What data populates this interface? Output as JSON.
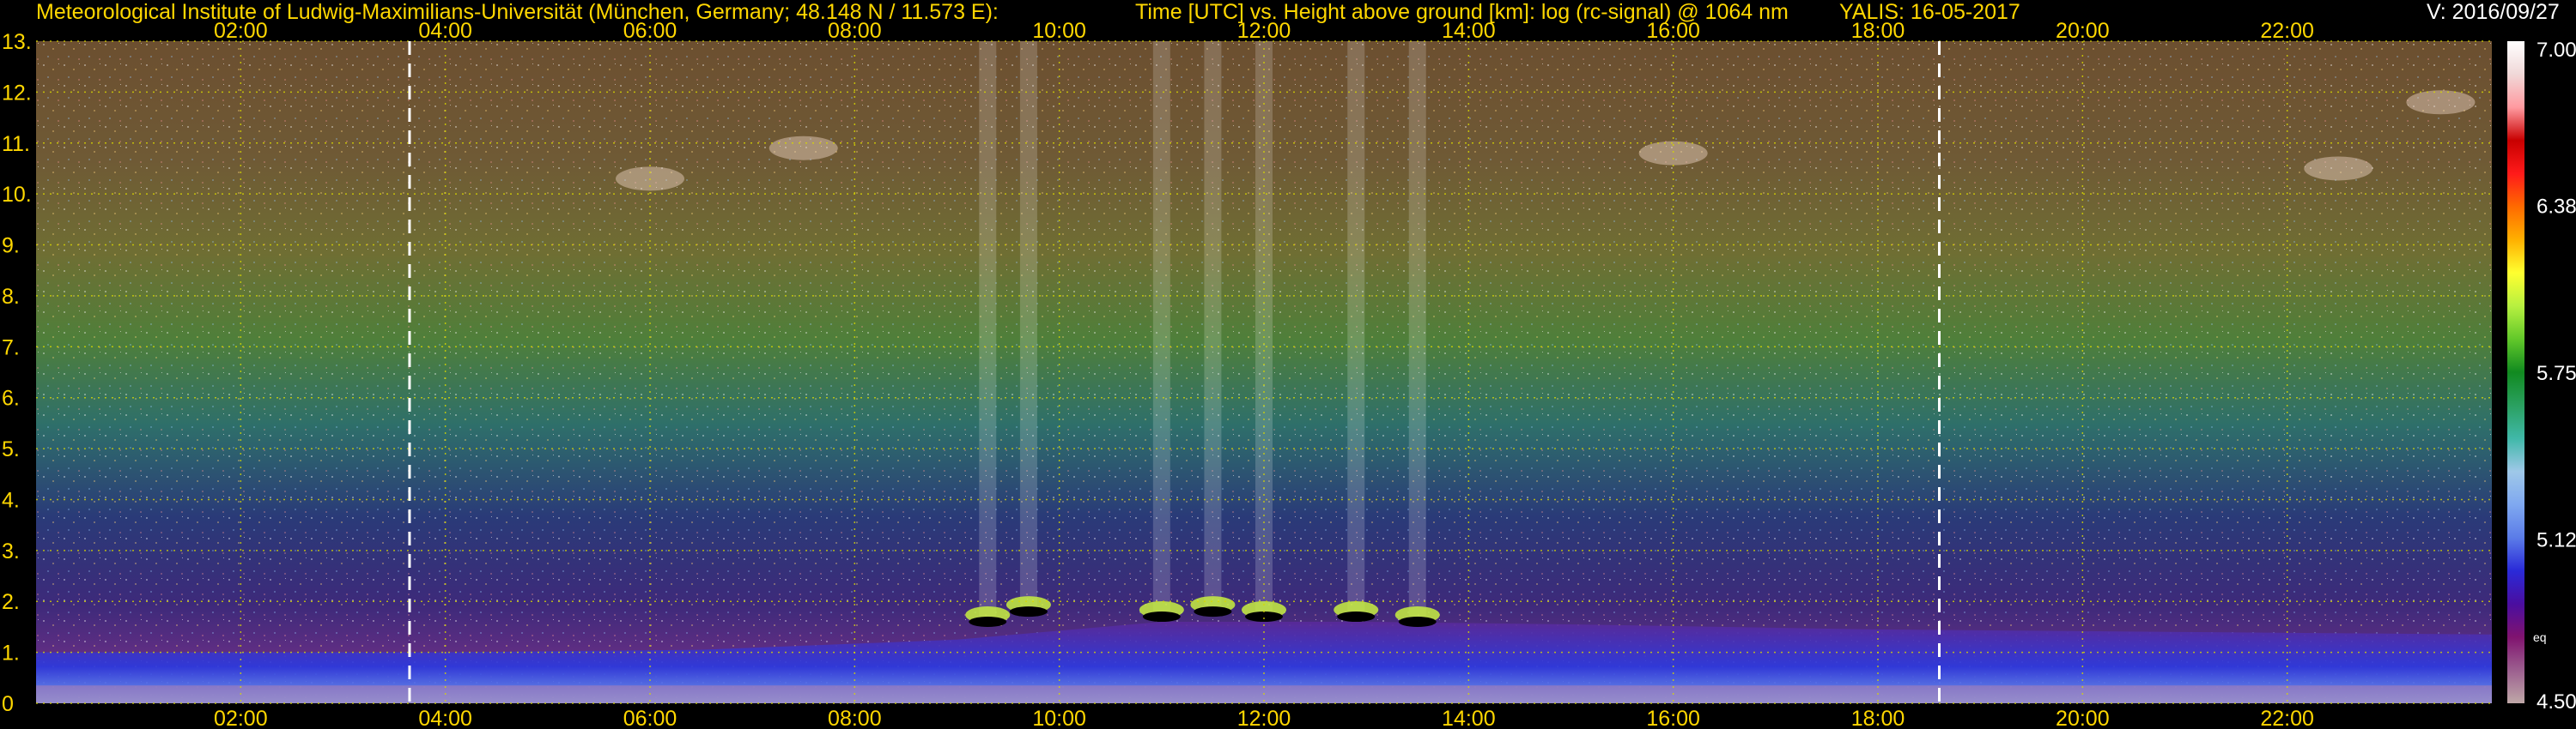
{
  "header": {
    "institute": "Meteorological Institute of Ludwig-Maximilians-Universität (München, Germany; 48.148 N / 11.573 E):",
    "plot_title": "Time [UTC] vs. Height above ground [km]: log (rc-signal) @ 1064 nm",
    "instrument_date": "YALIS: 16-05-2017",
    "version": "V: 2016/09/27"
  },
  "colors": {
    "header_text": "#ffd700",
    "version_text": "#ffffff",
    "grid": "#d8d800",
    "marker_lines": "#ffffff",
    "background": "#000000"
  },
  "colorbar": {
    "ticks": [
      "7.00",
      "6.38",
      "5.75",
      "5.12",
      "4.50"
    ],
    "tick_values": [
      7.0,
      6.38,
      5.75,
      5.12,
      4.5
    ],
    "range": [
      4.5,
      7.0
    ],
    "note": "eq",
    "stops": [
      "#bfa8a8",
      "#9c5f8f",
      "#80136f",
      "#4a0ea0",
      "#2a2ad8",
      "#5b7ce8",
      "#7fa8f0",
      "#9fc8e8",
      "#40b8a8",
      "#2aa060",
      "#118a20",
      "#62c82a",
      "#b7f040",
      "#ffff30",
      "#ffb000",
      "#ff6a00",
      "#ff1a1a",
      "#c80000",
      "#ff9aa0",
      "#f0d8d8",
      "#ffffff"
    ]
  },
  "chart_data": {
    "type": "heatmap",
    "title": "Time [UTC] vs. Height above ground [km]: log (rc-signal) @ 1064 nm",
    "xlabel": "Time [UTC]",
    "ylabel": "Height above ground [km]",
    "x_tick_labels": [
      "02:00",
      "04:00",
      "06:00",
      "08:00",
      "10:00",
      "12:00",
      "14:00",
      "16:00",
      "18:00",
      "20:00",
      "22:00"
    ],
    "x_tick_hours": [
      2,
      4,
      6,
      8,
      10,
      12,
      14,
      16,
      18,
      20,
      22
    ],
    "xlim_hours": [
      0,
      24
    ],
    "y_tick_labels": [
      "0",
      "1.",
      "2.",
      "3.",
      "4.",
      "5.",
      "6.",
      "7.",
      "8.",
      "9.",
      "10.",
      "11.",
      "12.",
      "13."
    ],
    "y_tick_values": [
      0,
      1,
      2,
      3,
      4,
      5,
      6,
      7,
      8,
      9,
      10,
      11,
      12,
      13
    ],
    "ylim_km": [
      0,
      13
    ],
    "grid": true,
    "colorbar_range": [
      4.5,
      7.0
    ],
    "marker_lines_hours": [
      3.65,
      18.6
    ],
    "boundary_layer_top_km": [
      {
        "hour": 0,
        "km": 1.0
      },
      {
        "hour": 4,
        "km": 1.0
      },
      {
        "hour": 6.5,
        "km": 1.05
      },
      {
        "hour": 9,
        "km": 1.25
      },
      {
        "hour": 11,
        "km": 1.6
      },
      {
        "hour": 13,
        "km": 1.6
      },
      {
        "hour": 15,
        "km": 1.55
      },
      {
        "hour": 18,
        "km": 1.45
      },
      {
        "hour": 21,
        "km": 1.4
      },
      {
        "hour": 24,
        "km": 1.35
      }
    ],
    "cloud_base_km": [
      {
        "hour": 9.3,
        "km": 1.6
      },
      {
        "hour": 9.7,
        "km": 1.8
      },
      {
        "hour": 11.0,
        "km": 1.7
      },
      {
        "hour": 11.5,
        "km": 1.8
      },
      {
        "hour": 12.0,
        "km": 1.7
      },
      {
        "hour": 12.9,
        "km": 1.7
      },
      {
        "hour": 13.5,
        "km": 1.6
      }
    ],
    "cirrus_patches": [
      {
        "hour": 6.0,
        "km": 10.3
      },
      {
        "hour": 7.5,
        "km": 10.9
      },
      {
        "hour": 16.0,
        "km": 10.8
      },
      {
        "hour": 22.5,
        "km": 10.5
      },
      {
        "hour": 23.5,
        "km": 11.8
      }
    ]
  }
}
